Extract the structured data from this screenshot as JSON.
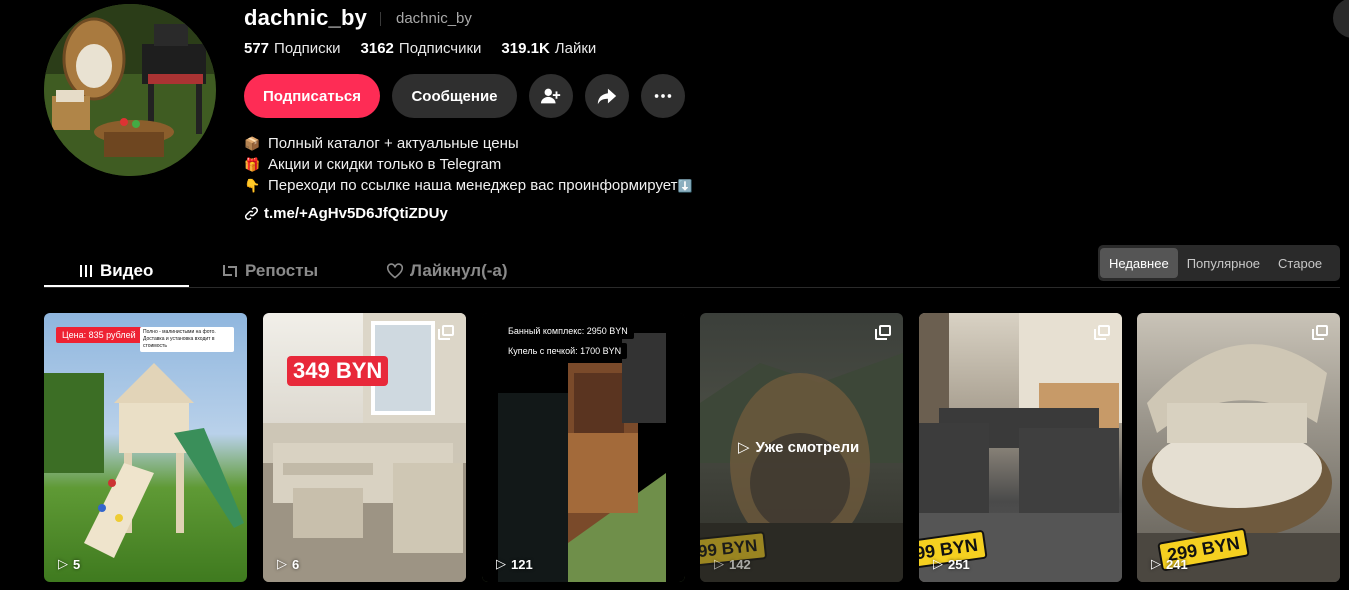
{
  "profile": {
    "username": "dachnic_by",
    "nickname": "dachnic_by",
    "stats": [
      {
        "value": "577",
        "label": "Подписки"
      },
      {
        "value": "3162",
        "label": "Подписчики"
      },
      {
        "value": "319.1K",
        "label": "Лайки"
      }
    ],
    "follow_label": "Подписаться",
    "message_label": "Сообщение",
    "bio": [
      {
        "icon": "package-icon",
        "glyph": "📦",
        "text": "Полный каталог + актуальные цены"
      },
      {
        "icon": "gift-icon",
        "glyph": "🎁",
        "text": "Акции и скидки только в Telegram"
      },
      {
        "icon": "pointing-down-icon",
        "glyph": "👇",
        "text": "Переходи по ссылке наша менеджер вас проинформирует"
      }
    ],
    "bio_tail_glyph": "⬇️",
    "link": "t.me/+AgHv5D6JfQtiZDUy"
  },
  "tabs": [
    {
      "label": "Видео",
      "icon": "grid-icon"
    },
    {
      "label": "Репосты",
      "icon": "repost-icon"
    },
    {
      "label": "Лайкнул(-а)",
      "icon": "liked-icon"
    }
  ],
  "sort": [
    "Недавнее",
    "Популярное",
    "Старое"
  ],
  "videos": [
    {
      "count": "5",
      "tag": "Цена: 835 рублей",
      "note": "Полно - малинистыми на фото. Доставка и установка входит в стоимость"
    },
    {
      "count": "6",
      "tag": "349 BYN"
    },
    {
      "count": "121",
      "label1": "Банный комплекс: 2950 BYN",
      "label2": "Купель с печкой: 1700 BYN"
    },
    {
      "count": "142",
      "tag": "99 BYN",
      "overlay": "Уже смотрели"
    },
    {
      "count": "251",
      "tag": "99 BYN"
    },
    {
      "count": "241",
      "tag": "299 BYN"
    }
  ],
  "colors": {
    "accent": "#fe2c55",
    "background": "#000000",
    "button": "#2f2f2f",
    "price_tag": "#f5d020"
  }
}
